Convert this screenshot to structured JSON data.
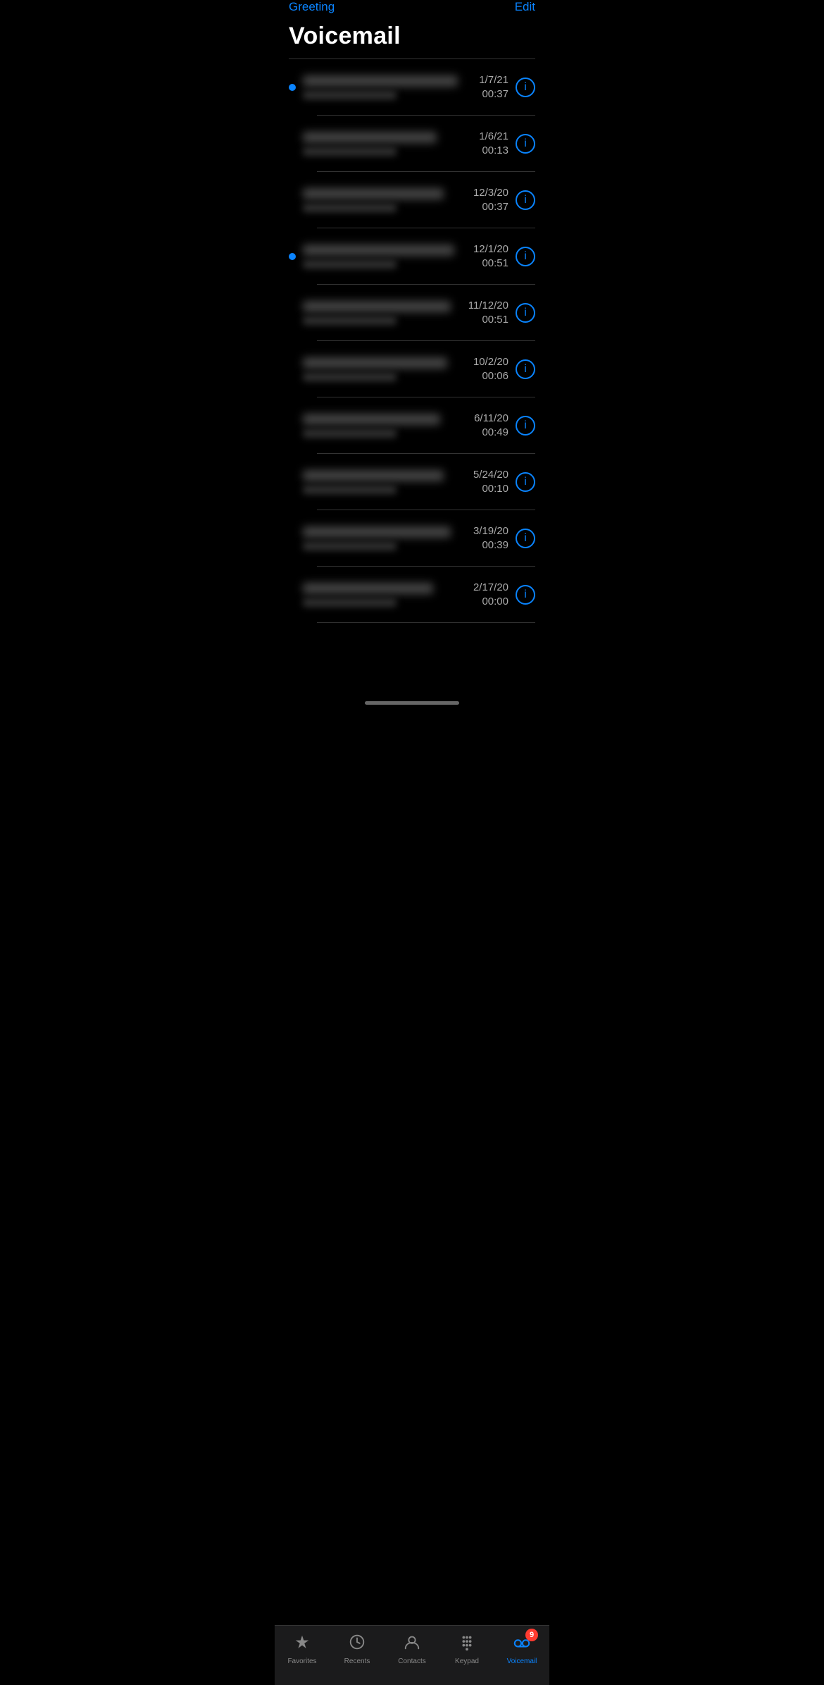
{
  "header": {
    "greeting_label": "Greeting",
    "edit_label": "Edit",
    "page_title": "Voicemail"
  },
  "voicemails": [
    {
      "id": 1,
      "unread": true,
      "date": "1/7/21",
      "duration": "00:37"
    },
    {
      "id": 2,
      "unread": false,
      "date": "1/6/21",
      "duration": "00:13"
    },
    {
      "id": 3,
      "unread": false,
      "date": "12/3/20",
      "duration": "00:37"
    },
    {
      "id": 4,
      "unread": true,
      "date": "12/1/20",
      "duration": "00:51"
    },
    {
      "id": 5,
      "unread": false,
      "date": "11/12/20",
      "duration": "00:51"
    },
    {
      "id": 6,
      "unread": false,
      "date": "10/2/20",
      "duration": "00:06"
    },
    {
      "id": 7,
      "unread": false,
      "date": "6/11/20",
      "duration": "00:49"
    },
    {
      "id": 8,
      "unread": false,
      "date": "5/24/20",
      "duration": "00:10"
    },
    {
      "id": 9,
      "unread": false,
      "date": "3/19/20",
      "duration": "00:39"
    },
    {
      "id": 10,
      "unread": false,
      "date": "2/17/20",
      "duration": "00:00"
    }
  ],
  "tabs": [
    {
      "id": "favorites",
      "label": "Favorites",
      "active": false
    },
    {
      "id": "recents",
      "label": "Recents",
      "active": false
    },
    {
      "id": "contacts",
      "label": "Contacts",
      "active": false
    },
    {
      "id": "keypad",
      "label": "Keypad",
      "active": false
    },
    {
      "id": "voicemail",
      "label": "Voicemail",
      "active": true,
      "badge": "9"
    }
  ],
  "name_widths": [
    220,
    190,
    200,
    215,
    210,
    205,
    195,
    200,
    210,
    185
  ]
}
